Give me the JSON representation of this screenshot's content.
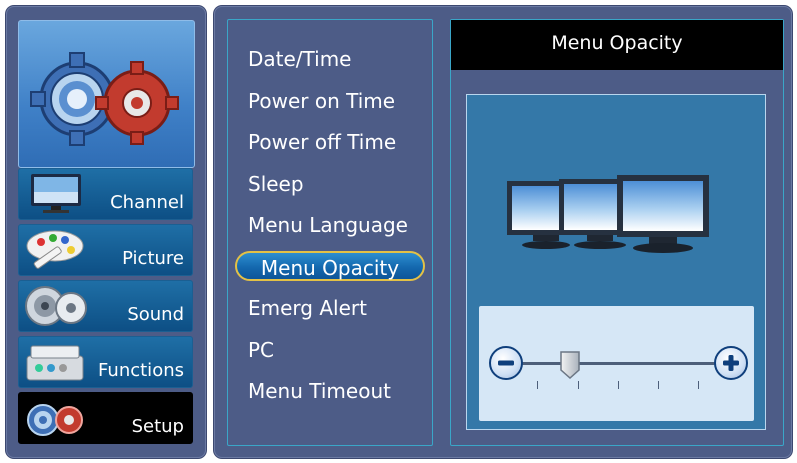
{
  "nav": {
    "categories": [
      {
        "label": "Channel",
        "icon": "tv-icon"
      },
      {
        "label": "Picture",
        "icon": "palette-icon"
      },
      {
        "label": "Sound",
        "icon": "speaker-icon"
      },
      {
        "label": "Functions",
        "icon": "toolbox-icon"
      },
      {
        "label": "Setup",
        "icon": "gears-icon",
        "selected": true
      }
    ],
    "hero_icon": "gears-icon"
  },
  "menu": {
    "items": [
      "Date/Time",
      "Power on Time",
      "Power off Time",
      "Sleep",
      "Menu Language",
      "Menu Opacity",
      "Emerg Alert",
      "PC",
      "Menu Timeout"
    ],
    "selected_index": 5
  },
  "detail": {
    "title": "Menu Opacity",
    "preview_icon": "monitors-icon",
    "slider": {
      "decrease_icon": "minus-icon",
      "increase_icon": "plus-icon",
      "value_fraction": 0.25,
      "ticks": 5
    }
  },
  "colors": {
    "panel": "#4d5c87",
    "accent_border": "#3aa6c8",
    "selection_outline": "#e3c146",
    "selected_fill": "#1468ae"
  }
}
